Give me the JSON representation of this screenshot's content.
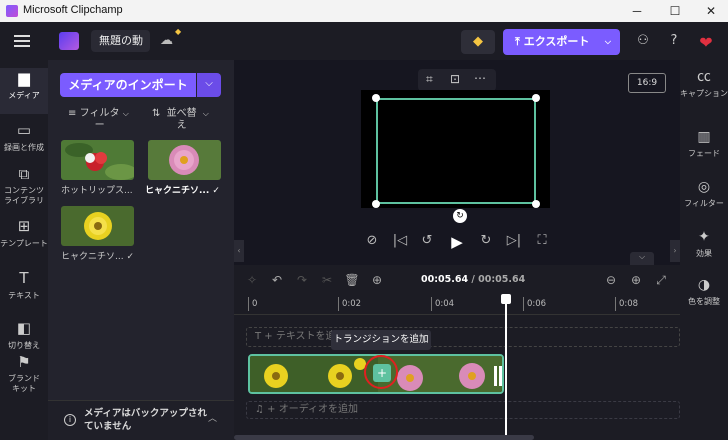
{
  "window": {
    "title": "Microsoft Clipchamp"
  },
  "topbar": {
    "project_name": "無題の動",
    "export_label": "エクスポート",
    "export_caret": "⌵"
  },
  "leftnav": [
    {
      "label": "メディア",
      "icon": "folder-icon"
    },
    {
      "label": "録画と作成",
      "icon": "video-camera-icon"
    },
    {
      "label": "コンテンツ\nライブラリ",
      "icon": "content-library-icon"
    },
    {
      "label": "テンプレート",
      "icon": "templates-icon"
    },
    {
      "label": "テキスト",
      "icon": "text-icon"
    },
    {
      "label": "切り替え",
      "icon": "transitions-icon"
    },
    {
      "label": "ブランド キット",
      "icon": "brand-kit-icon"
    }
  ],
  "media": {
    "import_label": "メディアのインポート",
    "filter_label": "フィルター",
    "sort_label": "並べ替え",
    "items": [
      {
        "name": "ホットリップス...",
        "check": ""
      },
      {
        "name": "ヒャクニチソ...",
        "check": "✓"
      },
      {
        "name": "ヒャクニチソ...",
        "check": "✓"
      }
    ],
    "backup_text": "メディアはバックアップされていません"
  },
  "preview": {
    "aspect_ratio": "16:9"
  },
  "timeline": {
    "current_time": "00:05.64",
    "total_time": "/ 00:05.64",
    "ticks": [
      "0",
      "0:02",
      "0:04",
      "0:06",
      "0:08"
    ],
    "text_track": "+ テキストを追加",
    "audio_track": "+ オーディオを追加",
    "tooltip": "トランジションを追加"
  },
  "rightpanel": [
    {
      "label": "キャプション",
      "icon": "captions-icon"
    },
    {
      "label": "フェード",
      "icon": "fade-icon"
    },
    {
      "label": "フィルター",
      "icon": "filters-icon"
    },
    {
      "label": "効果",
      "icon": "effects-icon"
    },
    {
      "label": "色を調整",
      "icon": "color-adjust-icon"
    }
  ],
  "colors": {
    "accent": "#7b5cff",
    "selection": "#5ec2a0",
    "highlight_circle": "#e02020"
  }
}
